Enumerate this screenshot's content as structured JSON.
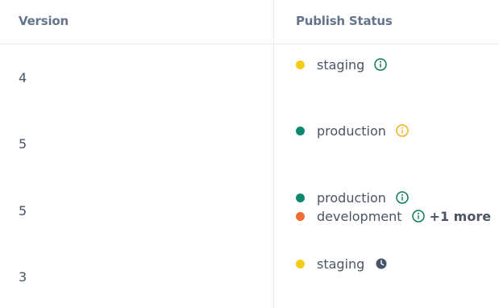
{
  "colors": {
    "staging": "#f5cc14",
    "production": "#0c8a70",
    "development": "#f26d35",
    "info_ok": "#0c7a5a",
    "info_warn": "#f2b01e",
    "clock": "#475569"
  },
  "table": {
    "headers": {
      "version": "Version",
      "publish_status": "Publish Status"
    },
    "rows": [
      {
        "version": "4",
        "statuses": [
          {
            "env": "staging",
            "icon": "info-icon",
            "icon_color": "#0c7a5a"
          }
        ]
      },
      {
        "version": "5",
        "statuses": [
          {
            "env": "production",
            "icon": "info-icon",
            "icon_color": "#f2b01e"
          }
        ]
      },
      {
        "version": "5",
        "statuses": [
          {
            "env": "production",
            "icon": "info-icon",
            "icon_color": "#0c7a5a"
          },
          {
            "env": "development",
            "icon": "info-icon",
            "icon_color": "#0c7a5a",
            "more": "+1 more"
          }
        ]
      },
      {
        "version": "3",
        "statuses": [
          {
            "env": "staging",
            "icon": "clock-icon",
            "icon_color": "#475569"
          }
        ]
      }
    ]
  }
}
